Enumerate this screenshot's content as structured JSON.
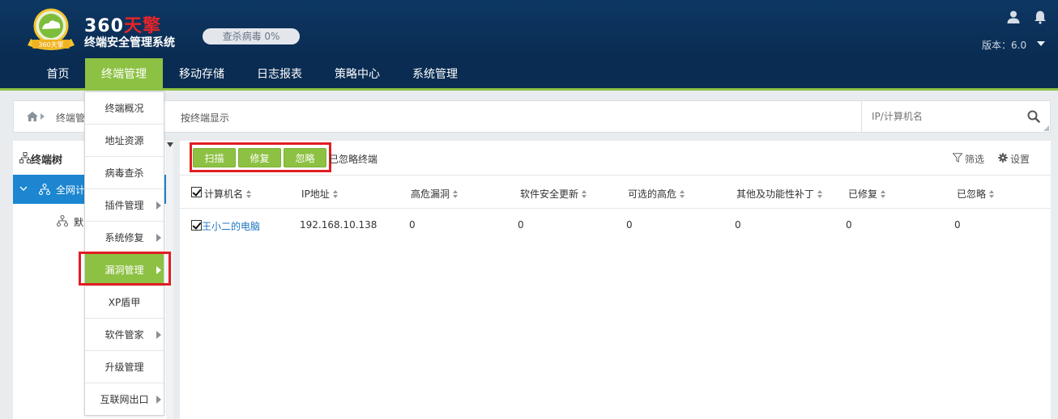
{
  "app": {
    "brand_number": "360",
    "brand_name": "天擎",
    "badge_text": "360天擎",
    "subtitle": "终端安全管理系统",
    "scan_status": "查杀病毒 0%",
    "version": "版本：6.0"
  },
  "nav": {
    "items": [
      {
        "label": "首页"
      },
      {
        "label": "终端管理",
        "active": true
      },
      {
        "label": "移动存储"
      },
      {
        "label": "日志报表"
      },
      {
        "label": "策略中心"
      },
      {
        "label": "系统管理"
      }
    ]
  },
  "breadcrumb": {
    "section": "终端管",
    "view": "按终端显示"
  },
  "search": {
    "placeholder": "IP/计算机名"
  },
  "dropdown": {
    "items": [
      {
        "label": "终端概况",
        "has_submenu": false
      },
      {
        "label": "地址资源",
        "has_submenu": false
      },
      {
        "label": "病毒查杀",
        "has_submenu": false
      },
      {
        "label": "插件管理",
        "has_submenu": true
      },
      {
        "label": "系统修复",
        "has_submenu": true
      },
      {
        "label": "漏洞管理",
        "has_submenu": true,
        "active": true
      },
      {
        "label": "XP盾甲",
        "has_submenu": false
      },
      {
        "label": "软件管家",
        "has_submenu": true
      },
      {
        "label": "升级管理",
        "has_submenu": false
      },
      {
        "label": "互联网出口",
        "has_submenu": true
      }
    ]
  },
  "tree": {
    "title": "终端树",
    "root_label": "全网计",
    "child_label": "默"
  },
  "toolbar": {
    "scan_label": "扫描",
    "repair_label": "修复",
    "ignore_label": "忽略",
    "ignored_label": "已忽略终端",
    "filter_label": "筛选",
    "settings_label": "设置"
  },
  "table": {
    "columns": [
      "计算机名",
      "IP地址",
      "高危漏洞",
      "软件安全更新",
      "可选的高危",
      "其他及功能性补丁",
      "已修复",
      "已忽略"
    ],
    "rows": [
      [
        "王小二的电脑",
        "192.168.10.138",
        "0",
        "0",
        "0",
        "0",
        "0",
        "0"
      ]
    ]
  },
  "colors": {
    "header_bg": "#0a2c52",
    "accent_green": "#8dc143",
    "selected_blue": "#1c86d1",
    "highlight_red": "#e11d23",
    "link_blue": "#1c76c4"
  },
  "icons": {
    "user": "user-icon",
    "bell": "bell-icon",
    "home": "home-icon",
    "search": "search-icon",
    "filter": "filter-icon",
    "gear": "gear-icon",
    "tree": "org-tree-icon"
  }
}
